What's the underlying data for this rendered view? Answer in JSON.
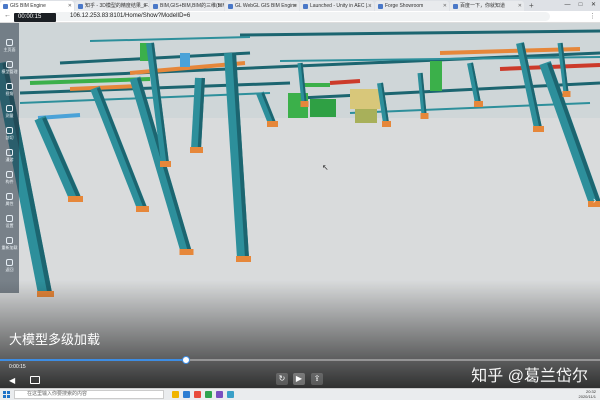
{
  "browser": {
    "tabs": [
      {
        "label": "GIS BIM Engine",
        "active": true
      },
      {
        "label": "知乎 - 3D模型的精度结果_IF...",
        "active": false
      },
      {
        "label": "BIM,GIS+BIM,BIM的三维(BIM)..",
        "active": false
      },
      {
        "label": "GL WebGL GIS BIM Engine",
        "active": false
      },
      {
        "label": "Launched - Unity in AEC |...",
        "active": false
      },
      {
        "label": "Forge Showroom",
        "active": false
      },
      {
        "label": "百度一下，你就知道",
        "active": false
      }
    ],
    "url": "106.12.253.83:8101/Home/Show?ModelID=6"
  },
  "timer": "00:00:15",
  "sidebar": {
    "items": [
      {
        "label": "主页面"
      },
      {
        "label": "模型管理"
      },
      {
        "label": "视角"
      },
      {
        "label": "测量"
      },
      {
        "label": "剖切"
      },
      {
        "label": "漫游"
      },
      {
        "label": "构件"
      },
      {
        "label": "属性"
      },
      {
        "label": "设置"
      },
      {
        "label": "重新加载"
      },
      {
        "label": "返回"
      }
    ]
  },
  "video": {
    "caption": "大模型多级加载",
    "current_time": "0:00:15",
    "progress": 0.31,
    "watermark": "知乎 @葛兰岱尔"
  },
  "taskbar": {
    "search_placeholder": "在这里输入你要搜索的内容",
    "clock_time": "20:32",
    "clock_date": "2020/11/1"
  },
  "colors": {
    "steel": "#2d8f9b",
    "steel_dark": "#1c6570",
    "pipe_green": "#3bb04a",
    "pipe_orange": "#e6873a",
    "pipe_red": "#cc3a2a",
    "floor": "#d9dbdc",
    "progress_blue": "#3d8de3"
  }
}
